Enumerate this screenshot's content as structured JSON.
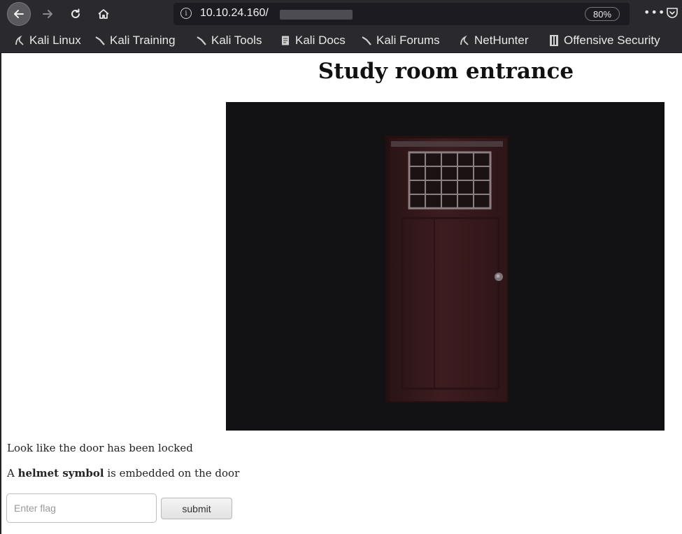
{
  "browser": {
    "url": "10.10.24.160/",
    "zoom": "80%",
    "more_label": "•••",
    "bookmarks": [
      {
        "label": "Kali Linux",
        "icon": "kali-dragon-icon"
      },
      {
        "label": "Kali Training",
        "icon": "kali-dragon-icon"
      },
      {
        "label": "Kali Tools",
        "icon": "kali-dragon-icon"
      },
      {
        "label": "Kali Docs",
        "icon": "document-icon"
      },
      {
        "label": "Kali Forums",
        "icon": "kali-dragon-icon"
      },
      {
        "label": "NetHunter",
        "icon": "kali-dragon-icon"
      },
      {
        "label": "Offensive Security",
        "icon": "offsec-icon"
      }
    ]
  },
  "page": {
    "title": "Study room entrance",
    "message_locked": "Look like the door has been locked",
    "hint": {
      "prefix": "A ",
      "bold": "helmet symbol",
      "suffix": " is embedded on the door"
    },
    "flag_input": {
      "placeholder": "Enter flag",
      "value": ""
    },
    "submit_label": "submit"
  },
  "colors": {
    "chrome_bg": "#2a2a2e",
    "urlbar_bg": "#1c1b22",
    "image_bg": "#121214",
    "door": "#3a1a1c"
  }
}
